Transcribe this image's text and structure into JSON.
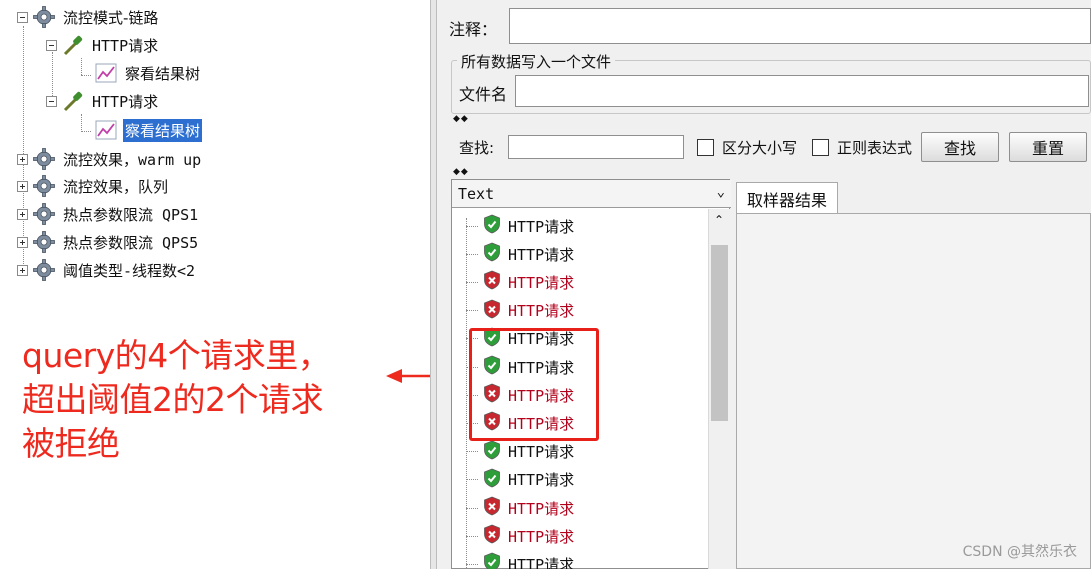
{
  "tree": {
    "items": [
      {
        "label": "流控模式-链路"
      },
      {
        "label": "HTTP请求"
      },
      {
        "label": "察看结果树"
      },
      {
        "label": "HTTP请求"
      },
      {
        "label": "察看结果树"
      },
      {
        "label": "流控效果，warm up"
      },
      {
        "label": "流控效果，队列"
      },
      {
        "label": "热点参数限流 QPS1"
      },
      {
        "label": "热点参数限流 QPS5"
      },
      {
        "label": "阈值类型-线程数<2"
      }
    ]
  },
  "annotation": {
    "lines": [
      "query的4个请求里，",
      "超出阈值2的2个请求",
      "被拒绝"
    ],
    "color": "#ee2a1f"
  },
  "panel": {
    "comment_label": "注释：",
    "comment_value": "",
    "file_group_title": "所有数据写入一个文件",
    "filename_label": "文件名",
    "filename_value": "",
    "search_label": "查找:",
    "search_value": "",
    "case_sensitive_label": "区分大小写",
    "regex_label": "正则表达式",
    "find_button": "查找",
    "reset_button": "重置",
    "renderer_value": "Text",
    "tab_label": "取样器结果"
  },
  "results": {
    "samples": [
      {
        "label": "HTTP请求",
        "status": "success"
      },
      {
        "label": "HTTP请求",
        "status": "success"
      },
      {
        "label": "HTTP请求",
        "status": "failure"
      },
      {
        "label": "HTTP请求",
        "status": "failure"
      },
      {
        "label": "HTTP请求",
        "status": "success"
      },
      {
        "label": "HTTP请求",
        "status": "success"
      },
      {
        "label": "HTTP请求",
        "status": "failure"
      },
      {
        "label": "HTTP请求",
        "status": "failure"
      },
      {
        "label": "HTTP请求",
        "status": "success"
      },
      {
        "label": "HTTP请求",
        "status": "success"
      },
      {
        "label": "HTTP请求",
        "status": "failure"
      },
      {
        "label": "HTTP请求",
        "status": "failure"
      },
      {
        "label": "HTTP请求",
        "status": "success"
      }
    ],
    "success_color": "#2e9e3a",
    "failure_color": "#c7282f"
  },
  "watermark": "CSDN @其然乐衣"
}
